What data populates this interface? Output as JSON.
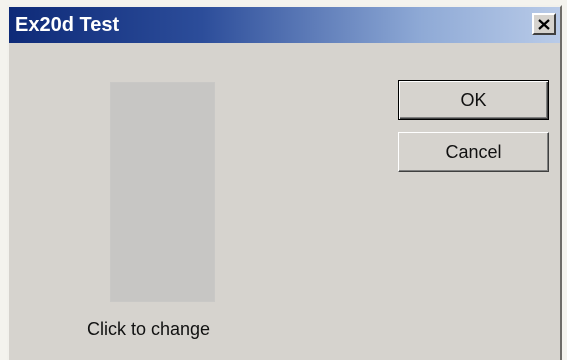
{
  "window": {
    "title": "Ex20d Test"
  },
  "icons": {
    "close": "close-icon"
  },
  "swatch": {
    "caption": "Click to change",
    "color": "#c7c6c4"
  },
  "buttons": {
    "ok_label": "OK",
    "cancel_label": "Cancel"
  }
}
